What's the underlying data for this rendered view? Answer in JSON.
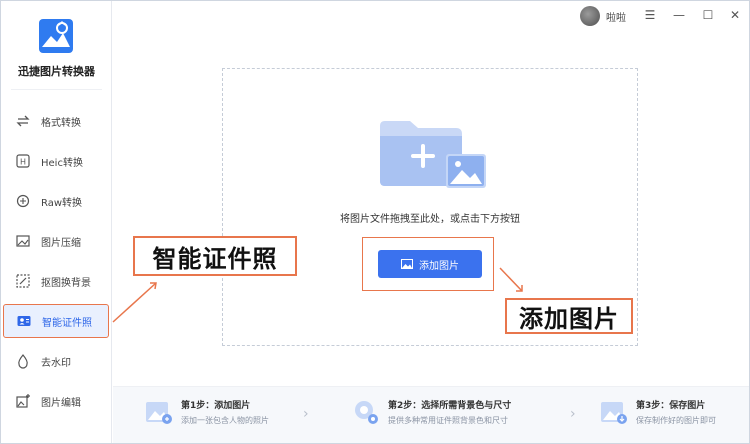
{
  "app": {
    "title": "迅捷图片转换器"
  },
  "sidebar": {
    "items": [
      {
        "label": "格式转换",
        "icon": "format-convert-icon"
      },
      {
        "label": "Heic转换",
        "icon": "heic-icon"
      },
      {
        "label": "Raw转换",
        "icon": "raw-icon"
      },
      {
        "label": "图片压缩",
        "icon": "image-compress-icon"
      },
      {
        "label": "抠图换背景",
        "icon": "cutout-icon"
      },
      {
        "label": "智能证件照",
        "icon": "id-photo-icon",
        "active": true
      },
      {
        "label": "去水印",
        "icon": "watermark-icon"
      },
      {
        "label": "图片编辑",
        "icon": "image-edit-icon"
      }
    ]
  },
  "titlebar": {
    "username": "啦啦",
    "menu_icon": "☰",
    "minimize_icon": "—",
    "maximize_icon": "☐",
    "close_icon": "✕"
  },
  "dropzone": {
    "hint": "将图片文件拖拽至此处，或点击下方按钮",
    "button_label": "添加图片"
  },
  "annotations": {
    "left_callout": "智能证件照",
    "right_callout": "添加图片"
  },
  "steps": [
    {
      "title": "第1步：添加图片",
      "desc": "添加一张包含人物的照片"
    },
    {
      "title": "第2步：选择所需背景色与尺寸",
      "desc": "提供多种常用证件照背景色和尺寸"
    },
    {
      "title": "第3步：保存图片",
      "desc": "保存制作好的图片即可"
    }
  ],
  "colors": {
    "accent": "#3b72ee",
    "highlight": "#e8764c",
    "active_bg": "#e9f0fe"
  }
}
